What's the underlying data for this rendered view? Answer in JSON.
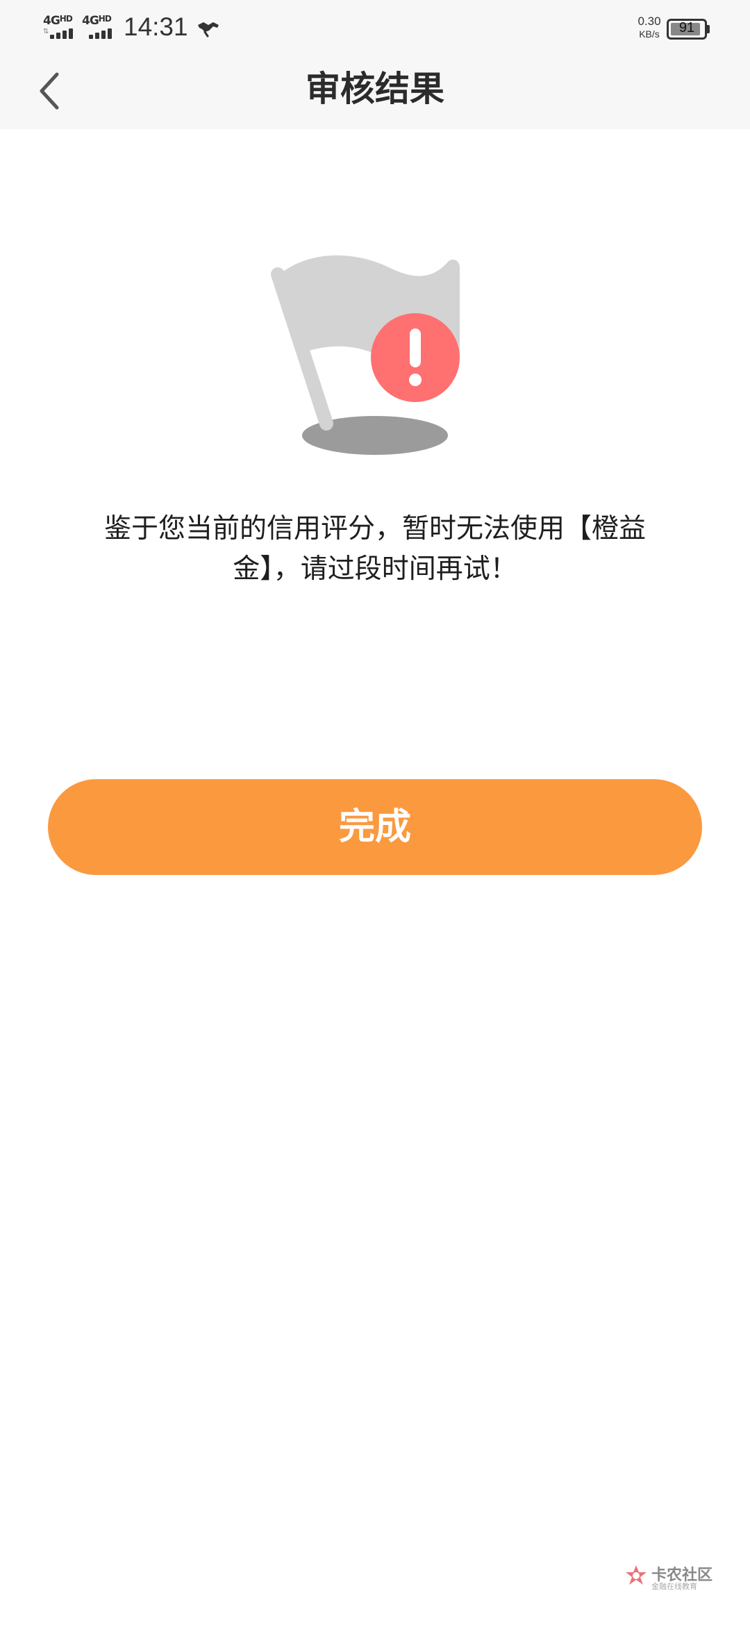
{
  "status_bar": {
    "sim1_label": "4G",
    "sim1_sup": "HD",
    "sim2_label": "4G",
    "sim2_sup": "HD",
    "time": "14:31",
    "app_icon": "handshake-icon",
    "net_speed_value": "0.30",
    "net_speed_unit": "KB/s",
    "battery_level": "91",
    "battery_percent": 91
  },
  "nav": {
    "back_icon": "chevron-left-icon",
    "title": "审核结果"
  },
  "illustration": {
    "icon": "flag-warning-icon",
    "colors": {
      "flag": "#d3d3d3",
      "shadow": "#9b9b9b",
      "badge": "#ff7070",
      "badge_mark": "#ffffff"
    }
  },
  "message": {
    "line1": "鉴于您当前的信用评分，暂时无法使用【橙益",
    "line2": "金】，请过段时间再试！"
  },
  "actions": {
    "done_label": "完成"
  },
  "watermark": {
    "title": "卡农社区",
    "subtitle": "金融在线教育",
    "icon": "kanong-logo-icon"
  },
  "theme": {
    "accent": "#fb993f",
    "bar_background": "#f7f7f7",
    "background": "#ffffff"
  }
}
